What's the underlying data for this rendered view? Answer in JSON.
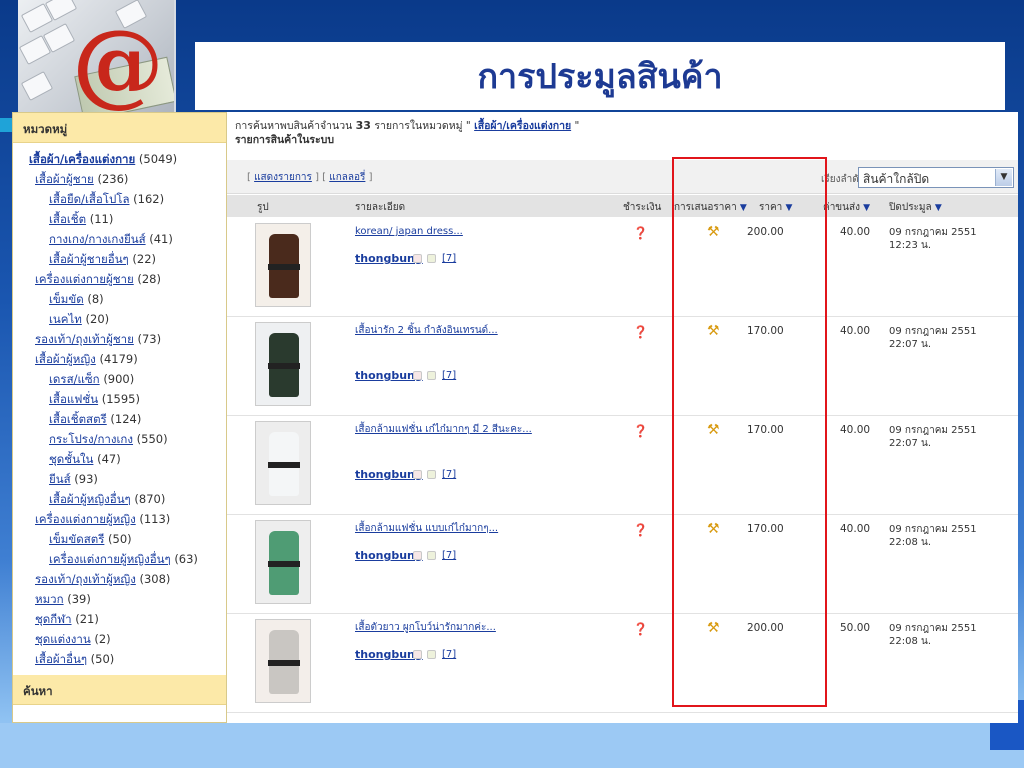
{
  "page": {
    "title": "การประมูลสินค้า"
  },
  "colors": {
    "title": "#1d3a93",
    "link": "#1a3d9e",
    "sidebar_header": "#fce9a8",
    "highlight_box": "#e1151b",
    "background_top": "#0a3a8a",
    "background_bottom": "#9ccaf5"
  },
  "sidebar": {
    "header": "หมวดหมู่",
    "search_header": "ค้นหา",
    "categories": [
      {
        "label": "เสื้อผ้า/เครื่องแต่งกาย",
        "count": "(5049)",
        "level": 0
      },
      {
        "label": "เสื้อผ้าผู้ชาย",
        "count": "(236)",
        "level": 1
      },
      {
        "label": "เสื้อยืด/เสื้อโปโล",
        "count": "(162)",
        "level": 2
      },
      {
        "label": "เสื้อเชิ้ต",
        "count": "(11)",
        "level": 2
      },
      {
        "label": "กางเกง/กางเกงยีนส์",
        "count": "(41)",
        "level": 2
      },
      {
        "label": "เสื้อผ้าผู้ชายอื่นๆ",
        "count": "(22)",
        "level": 2
      },
      {
        "label": "เครื่องแต่งกายผู้ชาย",
        "count": "(28)",
        "level": 1
      },
      {
        "label": "เข็มขัด",
        "count": "(8)",
        "level": 2
      },
      {
        "label": "เนคไท",
        "count": "(20)",
        "level": 2
      },
      {
        "label": "รองเท้า/ถุงเท้าผู้ชาย",
        "count": "(73)",
        "level": 1
      },
      {
        "label": "เสื้อผ้าผู้หญิง",
        "count": "(4179)",
        "level": 1
      },
      {
        "label": "เดรส/แซ็ก",
        "count": "(900)",
        "level": 2
      },
      {
        "label": "เสื้อแฟชั่น",
        "count": "(1595)",
        "level": 2
      },
      {
        "label": "เสื้อเชิ้ตสตรี",
        "count": "(124)",
        "level": 2
      },
      {
        "label": "กระโปรง/กางเกง",
        "count": "(550)",
        "level": 2
      },
      {
        "label": "ชุดชั้นใน",
        "count": "(47)",
        "level": 2
      },
      {
        "label": "ยีนส์",
        "count": "(93)",
        "level": 2
      },
      {
        "label": "เสื้อผ้าผู้หญิงอื่นๆ",
        "count": "(870)",
        "level": 2
      },
      {
        "label": "เครื่องแต่งกายผู้หญิง",
        "count": "(113)",
        "level": 1
      },
      {
        "label": "เข็มขัดสตรี",
        "count": "(50)",
        "level": 2
      },
      {
        "label": "เครื่องแต่งกายผู้หญิงอื่นๆ",
        "count": "(63)",
        "level": 2
      },
      {
        "label": "รองเท้า/ถุงเท้าผู้หญิง",
        "count": "(308)",
        "level": 1
      },
      {
        "label": "หมวก",
        "count": "(39)",
        "level": 1
      },
      {
        "label": "ชุดกีฬา",
        "count": "(21)",
        "level": 1
      },
      {
        "label": "ชุดแต่งงาน",
        "count": "(2)",
        "level": 1
      },
      {
        "label": "เสื้อผ้าอื่นๆ",
        "count": "(50)",
        "level": 1
      }
    ]
  },
  "summary": {
    "prefix": "การค้นหาพบสินค้าจำนวน",
    "count": "33",
    "middle": "รายการในหมวดหมู่ \"",
    "category_link": "เสื้อผ้า/เครื่องแต่งกาย",
    "suffix": "\"",
    "subtitle": "รายการสินค้าในระบบ"
  },
  "toolbar": {
    "open_bracket": "[",
    "list_view": "แสดงรายการ",
    "separator": "] [",
    "gallery_view": "แกลลอรี่",
    "close_bracket": "]",
    "sort_label": "เรียงลำดับ",
    "sort_value": "สินค้าใกล้ปิด"
  },
  "table": {
    "headers": {
      "image": "รูป",
      "detail": "รายละเอียด",
      "payment": "ชำระเงิน",
      "bid": "การเสนอราคา",
      "price": "ราคา",
      "shipping": "ค่าขนส่ง",
      "closing": "ปิดประมูล"
    },
    "rows": [
      {
        "title": "korean/ japan dress...",
        "seller": "thongbung",
        "feedback": "[7]",
        "price": "200.00",
        "shipping": "40.00",
        "close_date": "09 กรกฎาคม 2551",
        "close_time": "12:23 น."
      },
      {
        "title": "เสื้อน่ารัก 2 ชิ้น กำลังอินเทรนด์...",
        "seller": "thongbung",
        "feedback": "[7]",
        "price": "170.00",
        "shipping": "40.00",
        "close_date": "09 กรกฎาคม 2551",
        "close_time": "22:07 น."
      },
      {
        "title": "เสื้อกล้ามแฟชั่น เก๋ไก๋มากๆ มี 2 สีนะคะ...",
        "seller": "thongbung",
        "feedback": "[7]",
        "price": "170.00",
        "shipping": "40.00",
        "close_date": "09 กรกฎาคม 2551",
        "close_time": "22:07 น."
      },
      {
        "title": "เสื้อกล้ามแฟชั่น แบบเก๋ไก๋มากๆ...",
        "seller": "thongbung",
        "feedback": "[7]",
        "price": "170.00",
        "shipping": "40.00",
        "close_date": "09 กรกฎาคม 2551",
        "close_time": "22:08 น."
      },
      {
        "title": "เสื้อตัวยาว ผูกโบว์น่ารักมากค่ะ...",
        "seller": "thongbung",
        "feedback": "[7]",
        "price": "200.00",
        "shipping": "50.00",
        "close_date": "09 กรกฎาคม 2551",
        "close_time": "22:08 น."
      }
    ]
  }
}
